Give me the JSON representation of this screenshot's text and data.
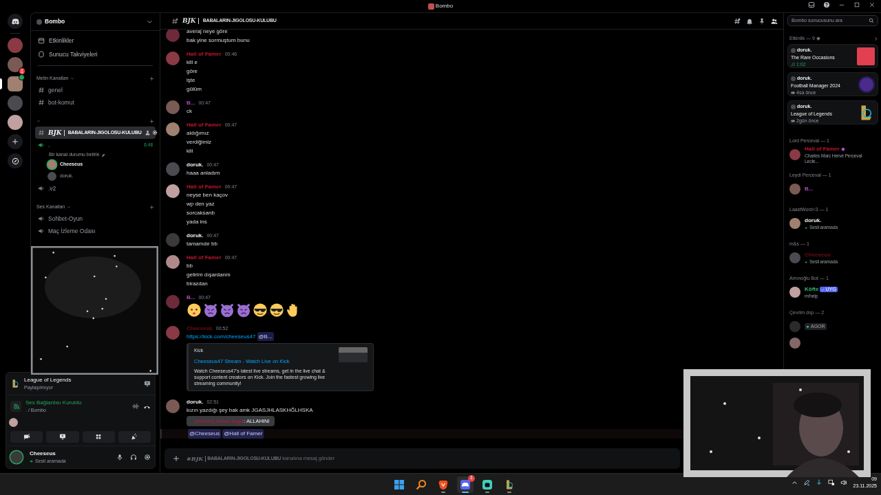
{
  "window": {
    "title": "Bombo"
  },
  "servers": [
    {
      "selected": false,
      "in_voice": false
    },
    {
      "selected": false,
      "in_voice": false,
      "badge": "1"
    },
    {
      "selected": true,
      "in_voice": true
    },
    {
      "selected": false,
      "in_voice": false
    },
    {
      "selected": false,
      "in_voice": false
    }
  ],
  "sidebar": {
    "server_name": "Bombo",
    "links": [
      {
        "kind": "events",
        "label": "Etkinlikler"
      },
      {
        "kind": "boosts",
        "label": "Sunucu Takviyeleri"
      }
    ],
    "categories": [
      {
        "name": "Metin Kanalları",
        "channels": [
          {
            "kind": "text",
            "name": "genel",
            "selected": false,
            "connected": false
          },
          {
            "kind": "text",
            "name": "bot-komut",
            "selected": false,
            "connected": false
          }
        ]
      },
      {
        "channels": [
          {
            "kind": "text",
            "prefix": "BJK",
            "name": "BABALARIN-JIGOLOSU-KULUBU",
            "selected": true,
            "connected": false
          },
          {
            "kind": "voice",
            "name": ".",
            "selected": false,
            "connected": true,
            "time": "6:48",
            "status": "Bir kanal durumu belirle",
            "members": [
              {
                "name": "Cheeseus",
                "speaking": true
              },
              {
                "name": "doruk.",
                "speaking": false
              }
            ]
          },
          {
            "kind": "voice",
            "name": ".v2",
            "selected": false,
            "connected": false
          }
        ]
      },
      {
        "name": "Ses Kanalları",
        "channels": [
          {
            "kind": "voice",
            "name": "Sohbet-Oyun",
            "selected": false,
            "connected": false
          },
          {
            "kind": "voice",
            "name": "Maç İzleme Odası",
            "selected": false,
            "connected": false
          }
        ]
      }
    ],
    "activity": {
      "title": "League of Legends",
      "subtitle": "Paylaşılmıyor"
    },
    "voice": {
      "status": "Ses Bağlantısı Kuruldu",
      "location": ". / Bombo"
    },
    "user": {
      "name": "Cheeseus",
      "status": "Sesli aramada"
    }
  },
  "chat": {
    "header": {
      "prefix": "BJK",
      "name": "BABALARIN-JIGOLOSU-KULUBU"
    },
    "search": {
      "placeholder": "Bombo sunucusunu ara"
    },
    "messages": [
      {
        "lines": [
          {
            "kind": "text",
            "text": "averaj neye göre"
          },
          {
            "kind": "text",
            "text": "bak yine sormuştum bunu"
          }
        ]
      },
      {
        "author": "Hall of Famer",
        "color": "#c0152f",
        "time": "00:46",
        "lines": [
          {
            "kind": "text",
            "text": "kill e"
          },
          {
            "kind": "text",
            "text": "göre"
          },
          {
            "kind": "text",
            "text": "işte"
          },
          {
            "kind": "text",
            "text": "gülüm"
          }
        ]
      },
      {
        "author": "B...",
        "color": "#b04ac8",
        "time": "00:47",
        "lines": [
          {
            "kind": "text",
            "text": "ck"
          }
        ]
      },
      {
        "author": "Hall of Famer",
        "color": "#c0152f",
        "time": "00:47",
        "lines": [
          {
            "kind": "text",
            "text": "aldığımız"
          },
          {
            "kind": "text",
            "text": "verdiğimiz"
          },
          {
            "kind": "text",
            "text": "kill"
          }
        ]
      },
      {
        "author": "doruk.",
        "time": "00:47",
        "lines": [
          {
            "kind": "text",
            "text": "haaa anladım"
          }
        ]
      },
      {
        "author": "Hall of Famer",
        "color": "#c0152f",
        "time": "00:47",
        "lines": [
          {
            "kind": "text",
            "text": "neyse ben kaçov"
          },
          {
            "kind": "text",
            "text": "wp den yaz"
          },
          {
            "kind": "text",
            "text": "sorcaksanb"
          },
          {
            "kind": "text",
            "text": "yada ins"
          }
        ]
      },
      {
        "author": "doruk.",
        "time": "00:47",
        "lines": [
          {
            "kind": "text",
            "text": "tamamdır bb"
          }
        ]
      },
      {
        "author": "Hall of Famer",
        "color": "#c0152f",
        "time": "00:47",
        "lines": [
          {
            "kind": "text",
            "text": "bb"
          },
          {
            "kind": "text",
            "text": "gelirim dışardanm"
          },
          {
            "kind": "text",
            "text": "birazdan"
          }
        ]
      },
      {
        "author": "B...",
        "color": "#b04ac8",
        "time": "00:47",
        "lines": [
          {
            "kind": "emoji",
            "emoji": [
              {
                "kind": "baby"
              },
              {
                "kind": "devil"
              },
              {
                "kind": "devil"
              },
              {
                "kind": "devil"
              },
              {
                "kind": "cool"
              },
              {
                "kind": "cool"
              },
              {
                "kind": "hand"
              }
            ]
          }
        ]
      },
      {
        "author": "Cheeseus",
        "color": "#6e0f1a",
        "time": "00:52",
        "lines": [
          {
            "kind": "link",
            "text": "https://kick.com/cheeseus47",
            "mention": "@B..."
          },
          {
            "kind": "embed",
            "provider": "Kick",
            "title": "Cheeseus47 Stream - Watch Live on Kick",
            "description": "Watch Cheeseus47's latest live streams, get in the live chat & support content creators on Kick. Join the fastest growing live streaming community!"
          }
        ]
      },
      {
        "author": "doruk.",
        "time": "02:51",
        "lines": [
          {
            "kind": "text",
            "text": "kızın yazdığı şey bak amk JGASJHLASKHĞLHSKA"
          },
          {
            "kind": "quote",
            "prefix": "(Herkes) Ahmet Kaya",
            "text": ": ALLAHINI"
          },
          {
            "kind": "mentions",
            "mentions": [
              "@Cheeseus",
              "@Hall of Famer"
            ]
          }
        ]
      }
    ],
    "composer": {
      "prefix": "#BJK",
      "channel": "BABALARIN-JIGOLOSU-KULUBU",
      "placeholder": "kanalına mesaj gönder"
    }
  },
  "members": {
    "activity_header": "Etkinlik — 9",
    "activities": [
      {
        "user": "doruk.",
        "title": "The Rare Occasions",
        "kind": "music",
        "detail": "1:02"
      },
      {
        "user": "doruk.",
        "title": "Football Manager 2024",
        "kind": "game_badge",
        "detail": "4sa önce"
      },
      {
        "user": "doruk.",
        "title": "League of Legends",
        "kind": "game_logo",
        "detail": "2gün önce"
      }
    ],
    "groups": [
      {
        "title": "Lord Perceval — 1",
        "members": [
          {
            "name": "Hall of Famer",
            "color": "#c0152f",
            "status": "Charles Marc Hervé Perceval Lecle...",
            "kind": "text",
            "boost": true,
            "offline": false
          }
        ]
      },
      {
        "title": "Leydi Perceval — 1",
        "members": [
          {
            "name": "B...",
            "color": "#b04ac8",
            "boost": false,
            "offline": false
          }
        ]
      },
      {
        "title": "LaastWord<3 — 1",
        "members": [
          {
            "name": "doruk.",
            "status": "Sesli aramada",
            "kind": "voice",
            "boost": false,
            "offline": false
          }
        ]
      },
      {
        "title": "m&s — 1",
        "members": [
          {
            "name": "Cheeseus",
            "color": "#6e0f1a",
            "status": "Sesli aramada",
            "kind": "voice",
            "boost": false,
            "offline": false
          }
        ]
      },
      {
        "title": "Amınoğlu Bot — 1",
        "members": [
          {
            "name": "Köfte",
            "color": "#2fbf71",
            "tag": "UYG",
            "status": "m!help",
            "kind": "text",
            "boost": false,
            "offline": false
          }
        ]
      },
      {
        "title": "Çevrim dışı — 2",
        "members": [
          {
            "gem_tag": "AGOR",
            "boost": false,
            "offline": true
          },
          {
            "boost": false,
            "offline": true
          }
        ]
      }
    ]
  },
  "taskbar": {
    "apps": [
      {
        "kind": "windows",
        "selected": false,
        "running": false
      },
      {
        "kind": "search",
        "selected": false,
        "running": false
      },
      {
        "kind": "shield",
        "selected": false,
        "running": true
      },
      {
        "kind": "chat",
        "selected": true,
        "running": true,
        "badge": "1"
      },
      {
        "kind": "tile",
        "selected": false,
        "running": true
      },
      {
        "kind": "l",
        "selected": false,
        "running": true
      }
    ],
    "time": "09",
    "date": "23.11.2025"
  }
}
